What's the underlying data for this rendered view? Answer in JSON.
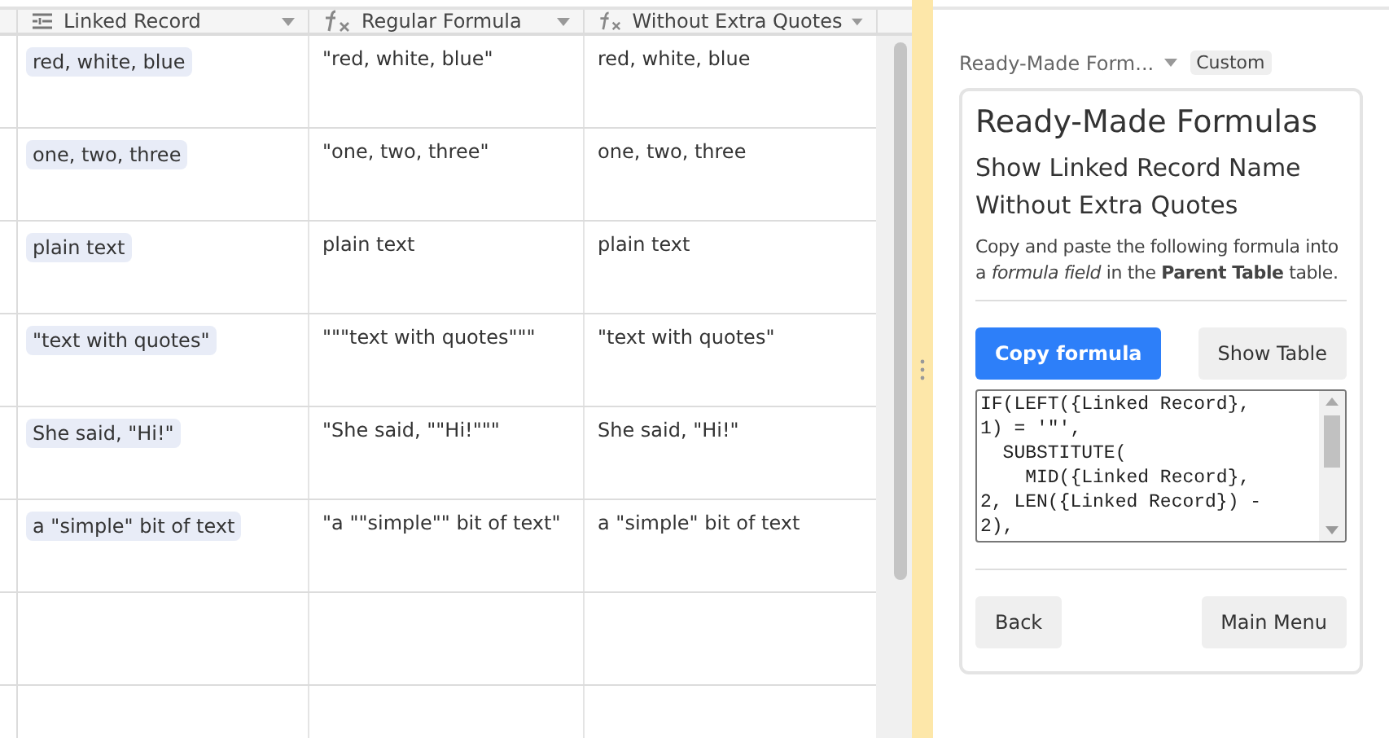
{
  "table": {
    "columns": [
      {
        "label": "Linked Record",
        "kind": "link"
      },
      {
        "label": "Regular Formula",
        "kind": "formula"
      },
      {
        "label": "Without Extra Quotes",
        "kind": "formula"
      }
    ],
    "rows": [
      [
        "red, white, blue",
        "\"red, white, blue\"",
        "red, white, blue"
      ],
      [
        "one, two, three",
        "\"one, two, three\"",
        "one, two, three"
      ],
      [
        "plain text",
        "plain text",
        "plain text"
      ],
      [
        "\"text with quotes\"",
        "\"\"\"text with quotes\"\"\"",
        "\"text with quotes\""
      ],
      [
        "She said, \"Hi!\"",
        "\"She said, \"\"Hi!\"\"\"",
        "She said, \"Hi!\""
      ],
      [
        "a \"simple\" bit of text",
        "\"a \"\"simple\"\" bit of text\"",
        "a \"simple\" bit of text"
      ],
      [
        "",
        "",
        ""
      ],
      [
        "",
        "",
        ""
      ]
    ]
  },
  "panel": {
    "selector": "Ready-Made Form...",
    "badge": "Custom",
    "title": "Ready-Made Formulas",
    "subtitle": "Show Linked Record Name Without Extra Quotes",
    "description": "Copy and paste the following formula into a *formula field* in the **Parent Table** table.",
    "copy_button": "Copy formula",
    "show_button": "Show Table",
    "formula": "IF(LEFT({Linked Record},\n1) = '\"',\n  SUBSTITUTE(\n    MID({Linked Record},\n2, LEN({Linked Record}) -\n2),",
    "back_button": "Back",
    "menu_button": "Main Menu"
  }
}
